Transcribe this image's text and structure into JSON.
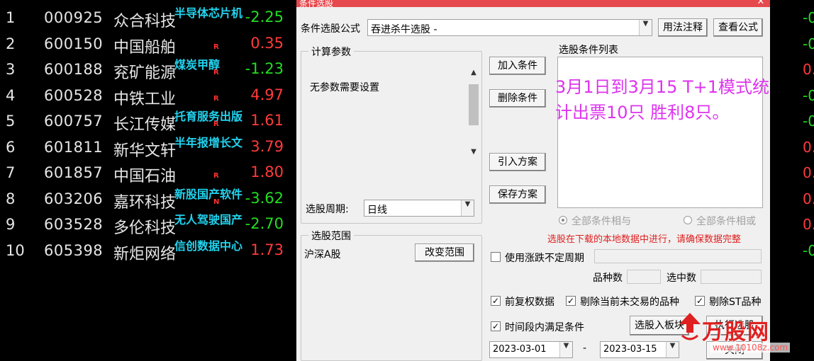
{
  "stocks": [
    {
      "idx": "1",
      "code": "000925",
      "name": "众合科技",
      "tag": "半导体芯片机",
      "r_mark": "",
      "pct": "-2.25",
      "dir": "down"
    },
    {
      "idx": "2",
      "code": "600150",
      "name": "中国船舶",
      "tag": "",
      "r_mark": "R",
      "pct": "0.35",
      "dir": "up"
    },
    {
      "idx": "3",
      "code": "600188",
      "name": "兖矿能源",
      "tag": "煤炭甲醇",
      "r_mark": "R",
      "pct": "-1.23",
      "dir": "down"
    },
    {
      "idx": "4",
      "code": "600528",
      "name": "中铁工业",
      "tag": "",
      "r_mark": "R",
      "pct": "4.97",
      "dir": "up"
    },
    {
      "idx": "5",
      "code": "600757",
      "name": "长江传媒",
      "tag": "托育服务出版",
      "r_mark": "R",
      "pct": "1.61",
      "dir": "up"
    },
    {
      "idx": "6",
      "code": "601811",
      "name": "新华文轩",
      "tag": "半年报增长文",
      "r_mark": "",
      "pct": "3.79",
      "dir": "up"
    },
    {
      "idx": "7",
      "code": "601857",
      "name": "中国石油",
      "tag": "",
      "r_mark": "R",
      "pct": "1.80",
      "dir": "up"
    },
    {
      "idx": "8",
      "code": "603206",
      "name": "嘉环科技",
      "tag": "新股国产软件",
      "r_mark": "N",
      "pct": "-3.62",
      "dir": "down"
    },
    {
      "idx": "9",
      "code": "603528",
      "name": "多伦科技",
      "tag": "无人驾驶国产",
      "r_mark": "",
      "pct": "-2.70",
      "dir": "down"
    },
    {
      "idx": "10",
      "code": "605398",
      "name": "新炬网络",
      "tag": "信创数据中心",
      "r_mark": "",
      "pct": "1.73",
      "dir": "up"
    }
  ],
  "right_strip": [
    {
      "val": "-0.",
      "dir": "down"
    },
    {
      "val": "-0.",
      "dir": "down"
    },
    {
      "val": "0.",
      "dir": "up"
    },
    {
      "val": "-0.",
      "dir": "down"
    },
    {
      "val": "-0.",
      "dir": "down"
    },
    {
      "val": "0.",
      "dir": "up"
    },
    {
      "val": "0.",
      "dir": "up"
    },
    {
      "val": "0.",
      "dir": "up"
    },
    {
      "val": "0.",
      "dir": "up"
    },
    {
      "val": "-0.",
      "dir": "down"
    }
  ],
  "dialog": {
    "title": "条件选股",
    "formula_label": "条件选股公式",
    "formula_value": "吞进杀牛选股 -",
    "usage_button": "用法注释",
    "view_formula_button": "查看公式",
    "params_group_title": "计算参数",
    "params_text": "无参数需要设置",
    "period_label": "选股周期:",
    "period_value": "日线",
    "range_group_title": "选股范围",
    "range_value": "沪深A股",
    "change_range_button": "改变范围",
    "add_condition_button": "加入条件",
    "delete_condition_button": "删除条件",
    "import_plan_button": "引入方案",
    "save_plan_button": "保存方案",
    "condition_list_label": "选股条件列表",
    "annotation_line1": "3月1日到3月15  T+1模式统",
    "annotation_line2": "计出票10只 胜利8只。",
    "all_and_label": "全部条件相与",
    "all_or_label": "全部条件相或",
    "warning_text": "选股在下载的本地数据中进行，请确保数据完整",
    "use_uncertain_label": "使用涨跌不定周期",
    "variety_count_label": "品种数",
    "selected_count_label": "选中数",
    "pre_adjust_label": "前复权数据",
    "exclude_untraded_label": "剔除当前未交易的品种",
    "exclude_st_label": "剔除ST品种",
    "time_range_label": "时间段内满足条件",
    "select_to_board_button": "选股入板块",
    "execute_button": "执行选股",
    "close_button": "关闭",
    "date_from": "2023-03-01",
    "date_to": "2023-03-15",
    "date_sep": "-"
  },
  "watermark": {
    "text": "万股网",
    "url": "www.10108z.com"
  },
  "colors": {
    "up": "#ff3b3b",
    "down": "#22dd22",
    "tag": "#22d3ee",
    "annotation": "#dd33ee",
    "warning": "#e02020"
  }
}
